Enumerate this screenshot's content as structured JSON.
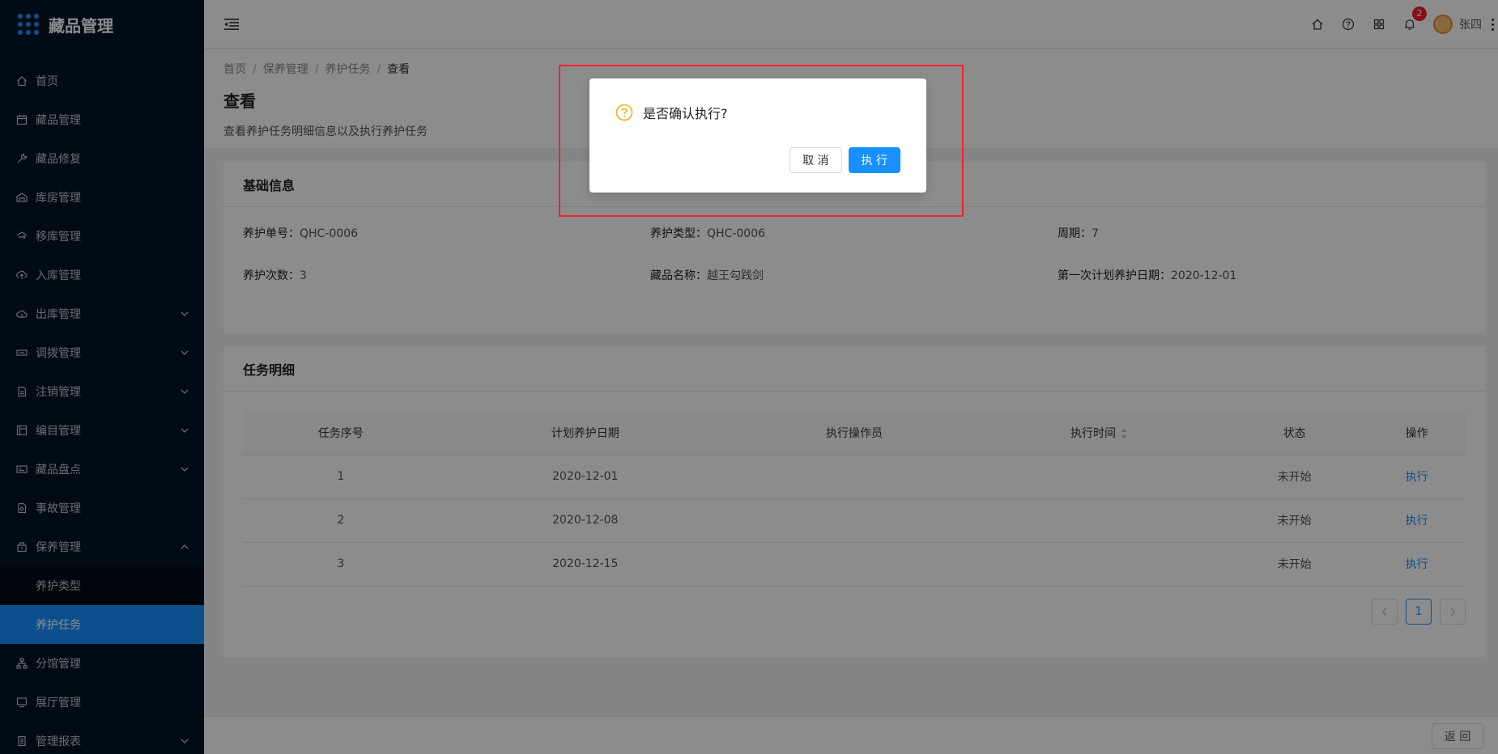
{
  "app": {
    "title": "藏品管理"
  },
  "sidebar": {
    "items": [
      {
        "label": "首页",
        "icon": "home-icon",
        "arrow": ""
      },
      {
        "label": "藏品管理",
        "icon": "calendar-icon",
        "arrow": ""
      },
      {
        "label": "藏品修复",
        "icon": "wrench-icon",
        "arrow": ""
      },
      {
        "label": "库房管理",
        "icon": "warehouse-icon",
        "arrow": ""
      },
      {
        "label": "移库管理",
        "icon": "transfer-icon",
        "arrow": ""
      },
      {
        "label": "入库管理",
        "icon": "upload-icon",
        "arrow": ""
      },
      {
        "label": "出库管理",
        "icon": "cloud-icon",
        "arrow": "down"
      },
      {
        "label": "调拨管理",
        "icon": "exchange-icon",
        "arrow": "down"
      },
      {
        "label": "注销管理",
        "icon": "file-icon",
        "arrow": "down"
      },
      {
        "label": "编目管理",
        "icon": "catalog-icon",
        "arrow": "down"
      },
      {
        "label": "藏品盘点",
        "icon": "inventory-icon",
        "arrow": "down"
      },
      {
        "label": "事故管理",
        "icon": "accident-icon",
        "arrow": ""
      },
      {
        "label": "保养管理",
        "icon": "maintenance-icon",
        "arrow": "up"
      }
    ],
    "subitems": [
      {
        "label": "养护类型"
      },
      {
        "label": "养护任务"
      }
    ],
    "bottom_items": [
      {
        "label": "分馆管理",
        "icon": "branch-icon",
        "arrow": ""
      },
      {
        "label": "展厅管理",
        "icon": "monitor-icon",
        "arrow": ""
      },
      {
        "label": "管理报表",
        "icon": "report-icon",
        "arrow": "down"
      }
    ]
  },
  "header": {
    "notification_count": "2",
    "username": "张四"
  },
  "breadcrumb": [
    "首页",
    "保养管理",
    "养护任务",
    "查看"
  ],
  "page": {
    "title": "查看",
    "description": "查看养护任务明细信息以及执行养护任务"
  },
  "basic_info": {
    "title": "基础信息",
    "fields": [
      {
        "label": "养护单号：",
        "value": "QHC-0006"
      },
      {
        "label": "养护类型：",
        "value": "QHC-0006"
      },
      {
        "label": "周期：",
        "value": "7"
      },
      {
        "label": "养护次数：",
        "value": "3"
      },
      {
        "label": "藏品名称：",
        "value": "越王勾践剑"
      },
      {
        "label": "第一次计划养护日期：",
        "value": "2020-12-01"
      }
    ]
  },
  "tasks": {
    "title": "任务明细",
    "columns": [
      "任务序号",
      "计划养护日期",
      "执行操作员",
      "执行时间",
      "状态",
      "操作"
    ],
    "rows": [
      {
        "no": "1",
        "date": "2020-12-01",
        "operator": "",
        "time": "",
        "status": "未开始",
        "action": "执行"
      },
      {
        "no": "2",
        "date": "2020-12-08",
        "operator": "",
        "time": "",
        "status": "未开始",
        "action": "执行"
      },
      {
        "no": "3",
        "date": "2020-12-15",
        "operator": "",
        "time": "",
        "status": "未开始",
        "action": "执行"
      }
    ],
    "pagination": {
      "current": "1"
    }
  },
  "footer": {
    "back_label": "返 回"
  },
  "modal": {
    "title": "是否确认执行?",
    "cancel_label": "取 消",
    "ok_label": "执 行"
  }
}
